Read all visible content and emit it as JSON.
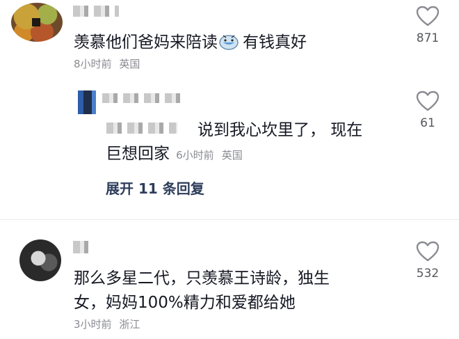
{
  "comments": [
    {
      "text_before": "羡慕他们爸妈来陪读",
      "emoji": "crying-face-emoji",
      "text_after": "有钱真好",
      "time": "8小时前",
      "location": "英国",
      "likes": "871",
      "replies": [
        {
          "line1": "说到我心坎里了， 现在",
          "line2": "巨想回家",
          "time": "6小时前",
          "location": "英国",
          "likes": "61"
        }
      ],
      "expand_label": "展开 11 条回复"
    },
    {
      "line1": "那么多星二代，只羡慕王诗龄，独生",
      "line2": "女，妈妈100%精力和爱都给她",
      "time": "3小时前",
      "location": "浙江",
      "likes": "532"
    }
  ],
  "icons": {
    "like": "heart-outline-icon"
  },
  "colors": {
    "text": "#161823",
    "meta": "#8a8b91",
    "expand": "#2d3d5a"
  }
}
